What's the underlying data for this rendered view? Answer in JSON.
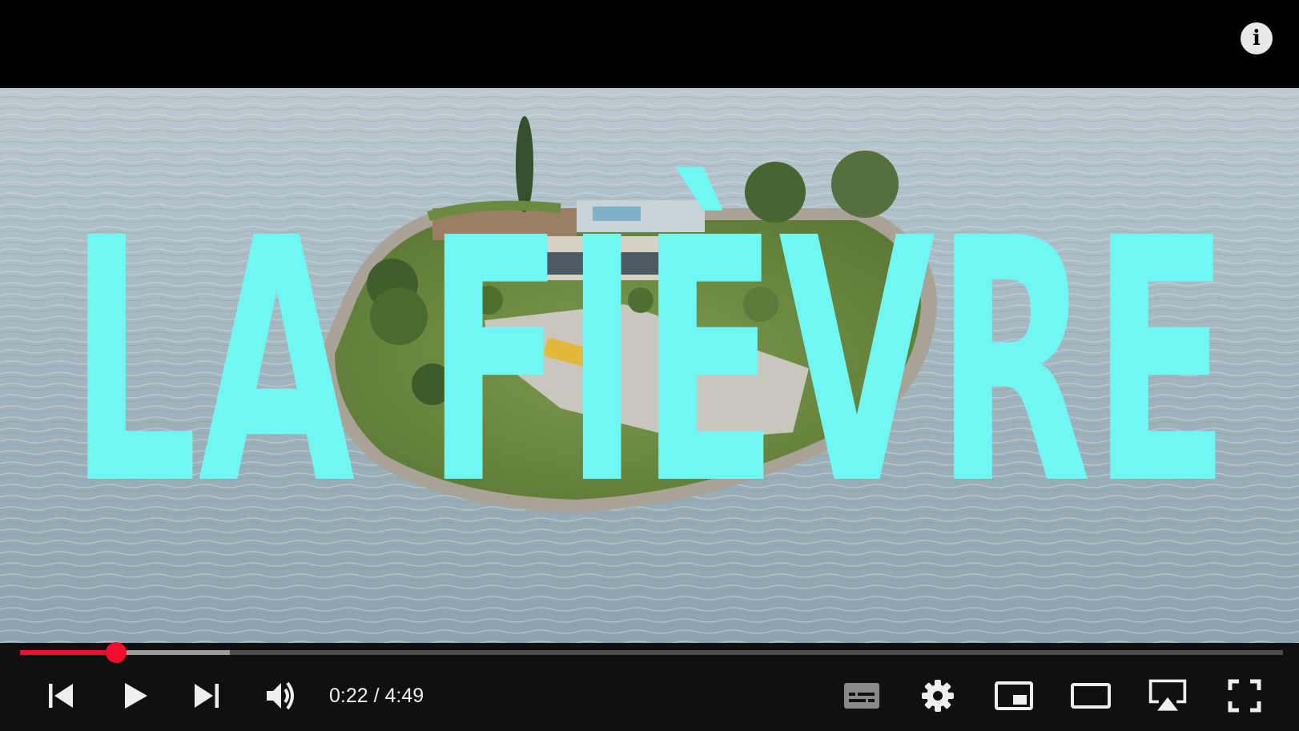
{
  "video": {
    "title_text": "LA FIÈVRE",
    "title_color": "#6ff7f4"
  },
  "player": {
    "info_button_glyph": "i",
    "progress": {
      "played_fraction": 0.076,
      "buffered_fraction": 0.166,
      "played_color": "#f20d2c"
    },
    "time": {
      "current": "0:22",
      "separator": " / ",
      "duration": "4:49"
    },
    "controls_left": [
      {
        "name": "previous-button",
        "icon": "skip-previous-icon"
      },
      {
        "name": "play-button",
        "icon": "play-icon"
      },
      {
        "name": "next-button",
        "icon": "skip-next-icon"
      },
      {
        "name": "volume-button",
        "icon": "volume-icon"
      }
    ],
    "controls_right": [
      {
        "name": "subtitles-button",
        "icon": "subtitles-icon"
      },
      {
        "name": "settings-button",
        "icon": "gear-icon"
      },
      {
        "name": "miniplayer-button",
        "icon": "miniplayer-icon"
      },
      {
        "name": "theater-mode-button",
        "icon": "theater-icon"
      },
      {
        "name": "airplay-button",
        "icon": "airplay-icon"
      },
      {
        "name": "fullscreen-button",
        "icon": "fullscreen-icon"
      }
    ]
  }
}
